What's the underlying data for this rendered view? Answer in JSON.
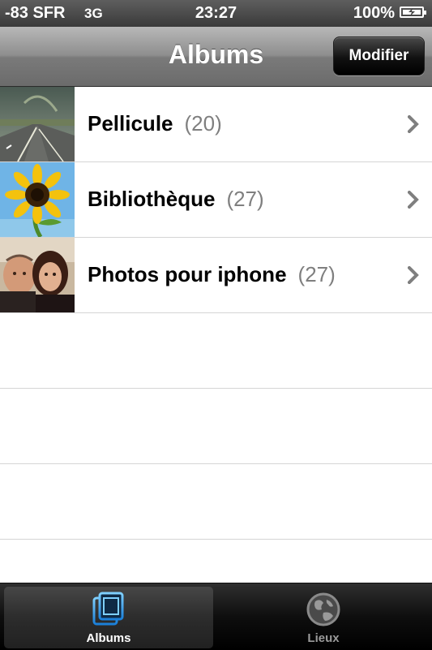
{
  "status_bar": {
    "signal_carrier": "-83 SFR",
    "network": "3G",
    "time": "23:27",
    "battery_percent": "100%",
    "battery_icon": "battery-charging-icon"
  },
  "nav_bar": {
    "title": "Albums",
    "edit_button": "Modifier"
  },
  "albums": [
    {
      "title": "Pellicule",
      "count": "(20)",
      "thumb_icon": "road-rainbow-thumbnail"
    },
    {
      "title": "Bibliothèque",
      "count": "(27)",
      "thumb_icon": "sunflower-thumbnail"
    },
    {
      "title": "Photos pour iphone",
      "count": "(27)",
      "thumb_icon": "couple-selfie-thumbnail"
    }
  ],
  "tab_bar": {
    "tabs": [
      {
        "label": "Albums",
        "icon": "albums-icon",
        "selected": true
      },
      {
        "label": "Lieux",
        "icon": "globe-icon",
        "selected": false
      }
    ]
  },
  "colors": {
    "accent_blue": "#3aa0e8",
    "count_gray": "#7f7f7f",
    "separator": "#d5d5d5"
  }
}
